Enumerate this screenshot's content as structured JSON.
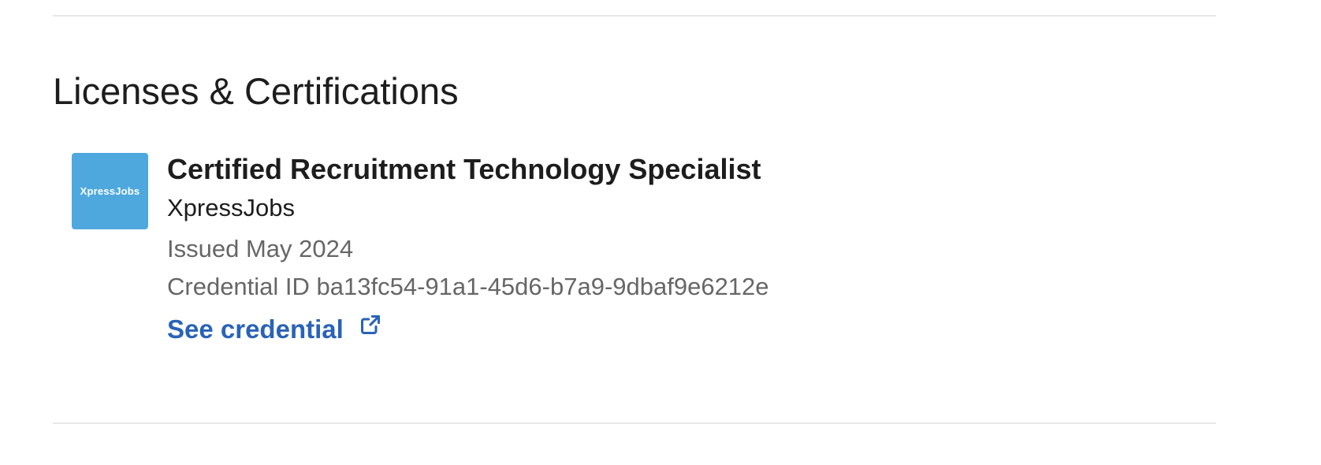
{
  "section": {
    "title": "Licenses & Certifications"
  },
  "certification": {
    "logo_text": "XpressJobs",
    "name": "Certified Recruitment Technology Specialist",
    "issuer": "XpressJobs",
    "issued": "Issued May 2024",
    "credential_id": "Credential ID ba13fc54-91a1-45d6-b7a9-9dbaf9e6212e",
    "see_credential_label": "See credential",
    "link_icon": "external-link-icon"
  },
  "colors": {
    "logo_bg": "#4ea8de",
    "link": "#2a63b7",
    "heading": "#1d1d1d",
    "muted": "#666666",
    "divider": "#e8e8e8"
  }
}
